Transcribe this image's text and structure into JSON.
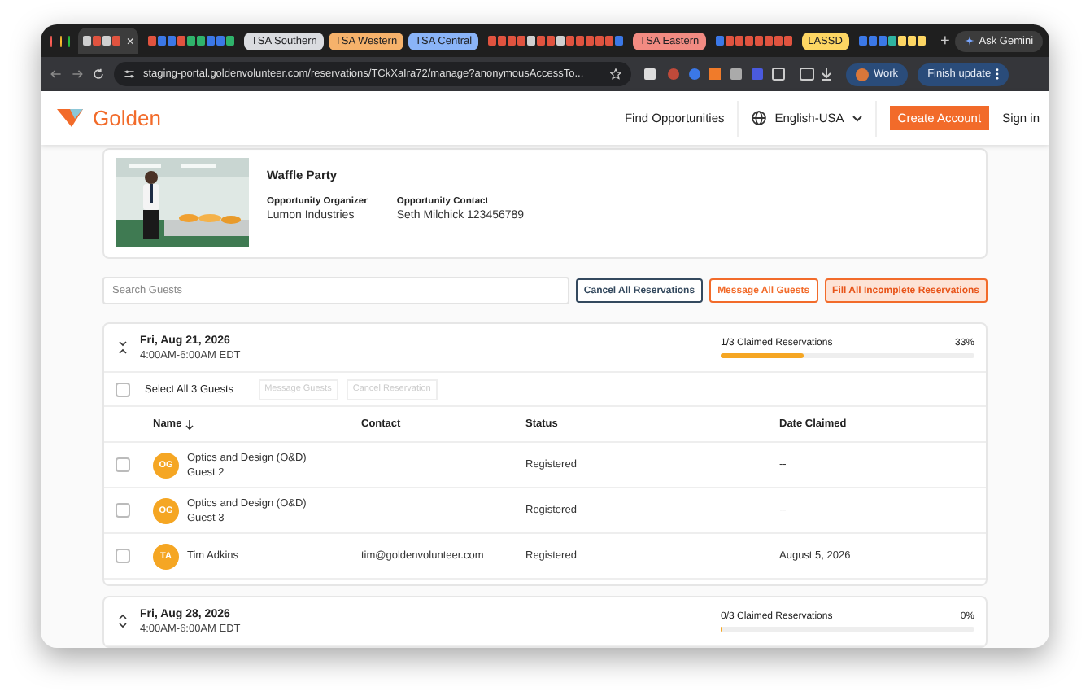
{
  "browser": {
    "tabs": [
      {
        "kind": "favicons",
        "selected": true,
        "close": "×",
        "icons": [
          {
            "color": "#cfcfcf"
          },
          {
            "color": "#e0533f"
          },
          {
            "color": "#cfcfcf"
          },
          {
            "color": "#e0533f"
          }
        ]
      },
      {
        "kind": "favicons",
        "selected": false,
        "icons": [
          {
            "color": "#e0533f"
          },
          {
            "color": "#3b78e7"
          },
          {
            "color": "#3b78e7"
          },
          {
            "color": "#e0533f"
          },
          {
            "color": "#2fb36b"
          },
          {
            "color": "#2fb36b"
          },
          {
            "color": "#3b78e7"
          },
          {
            "color": "#3b78e7"
          },
          {
            "color": "#2fb36b"
          }
        ]
      },
      {
        "kind": "group",
        "label": "TSA Southern",
        "color": "#dadce0",
        "selected": false
      },
      {
        "kind": "group",
        "label": "TSA Western",
        "color": "#f6b26b",
        "selected": false
      },
      {
        "kind": "group",
        "label": "TSA Central",
        "color": "#8ab4f8",
        "selected": false
      },
      {
        "kind": "favicons",
        "selected": false,
        "icons": [
          {
            "color": "#e0533f"
          },
          {
            "color": "#e0533f"
          },
          {
            "color": "#e0533f"
          },
          {
            "color": "#e0533f"
          },
          {
            "color": "#cfcfcf"
          },
          {
            "color": "#e0533f"
          },
          {
            "color": "#e0533f"
          },
          {
            "color": "#cfcfcf"
          },
          {
            "color": "#e0533f"
          },
          {
            "color": "#e0533f"
          },
          {
            "color": "#e0533f"
          },
          {
            "color": "#e0533f"
          },
          {
            "color": "#e0533f"
          },
          {
            "color": "#3b78e7"
          }
        ]
      },
      {
        "kind": "group",
        "label": "TSA Eastern",
        "color": "#f28b82",
        "selected": false
      },
      {
        "kind": "favicons",
        "selected": false,
        "icons": [
          {
            "color": "#3b78e7"
          },
          {
            "color": "#e0533f"
          },
          {
            "color": "#e0533f"
          },
          {
            "color": "#e0533f"
          },
          {
            "color": "#e0533f"
          },
          {
            "color": "#e0533f"
          },
          {
            "color": "#e0533f"
          },
          {
            "color": "#e0533f"
          }
        ]
      },
      {
        "kind": "group",
        "label": "LASSD",
        "color": "#fdd663",
        "selected": false
      },
      {
        "kind": "favicons",
        "selected": false,
        "icons": [
          {
            "color": "#3b78e7"
          },
          {
            "color": "#3b78e7"
          },
          {
            "color": "#3b78e7"
          },
          {
            "color": "#2fb3a0"
          },
          {
            "color": "#fdd663"
          },
          {
            "color": "#fdd663"
          },
          {
            "color": "#fdd663"
          }
        ]
      }
    ],
    "new_tab": "+",
    "gemini": "Ask Gemini",
    "url": "staging-portal.goldenvolunteer.com/reservations/TCkXaIra72/manage?anonymousAccessTo...",
    "profile": "Work",
    "update": "Finish update"
  },
  "header": {
    "logo": "Golden",
    "nav": "Find Opportunities",
    "language": "English-USA",
    "create": "Create Account",
    "sign_in": "Sign in"
  },
  "event": {
    "title": "Waffle Party",
    "fields": [
      {
        "label": "Opportunity Organizer",
        "value": "Lumon Industries"
      },
      {
        "label": "Opportunity Contact",
        "value": "Seth Milchick 123456789"
      }
    ]
  },
  "search": {
    "placeholder": "Search Guests"
  },
  "actions": [
    {
      "label": "Cancel All Reservations",
      "kind": "dark"
    },
    {
      "label": "Message All Guests",
      "kind": "outline"
    },
    {
      "label": "Fill All Incomplete Reservations",
      "kind": "filled"
    }
  ],
  "groups": [
    {
      "date": "Fri, Aug 21, 2026",
      "time": "4:00AM-6:00AM EDT",
      "claimed": "1/3 Claimed Reservations",
      "percent": "33%",
      "level": 0.33,
      "expanded": true,
      "select_all": "Select All 3 Guests",
      "select_all_checked": false,
      "bulk_actions": [
        {
          "label": "Message Guests",
          "disabled": true
        },
        {
          "label": "Cancel Reservation",
          "disabled": true
        }
      ],
      "columns": [
        {
          "label": "Name",
          "sorted": true
        },
        {
          "label": "Contact",
          "sorted": false
        },
        {
          "label": "Status",
          "sorted": false
        },
        {
          "label": "Date Claimed",
          "sorted": false
        }
      ],
      "guests": [
        {
          "initials": "OG",
          "name": "Optics and Design (O&D)",
          "subtitle": "Guest 2",
          "status": "Registered",
          "date_claimed": "--",
          "checked": false
        },
        {
          "initials": "OG",
          "name": "Optics and Design (O&D)",
          "subtitle": "Guest 3",
          "status": "Registered",
          "date_claimed": "--",
          "checked": false
        },
        {
          "initials": "TA",
          "name": "Tim Adkins",
          "contact": "tim@goldenvolunteer.com",
          "status": "Registered",
          "date_claimed": "August 5, 2026",
          "checked": false
        }
      ]
    },
    {
      "date": "Fri, Aug 28, 2026",
      "time": "4:00AM-6:00AM EDT",
      "claimed": "0/3 Claimed Reservations",
      "percent": "0%",
      "level": 0,
      "expanded": false
    }
  ]
}
